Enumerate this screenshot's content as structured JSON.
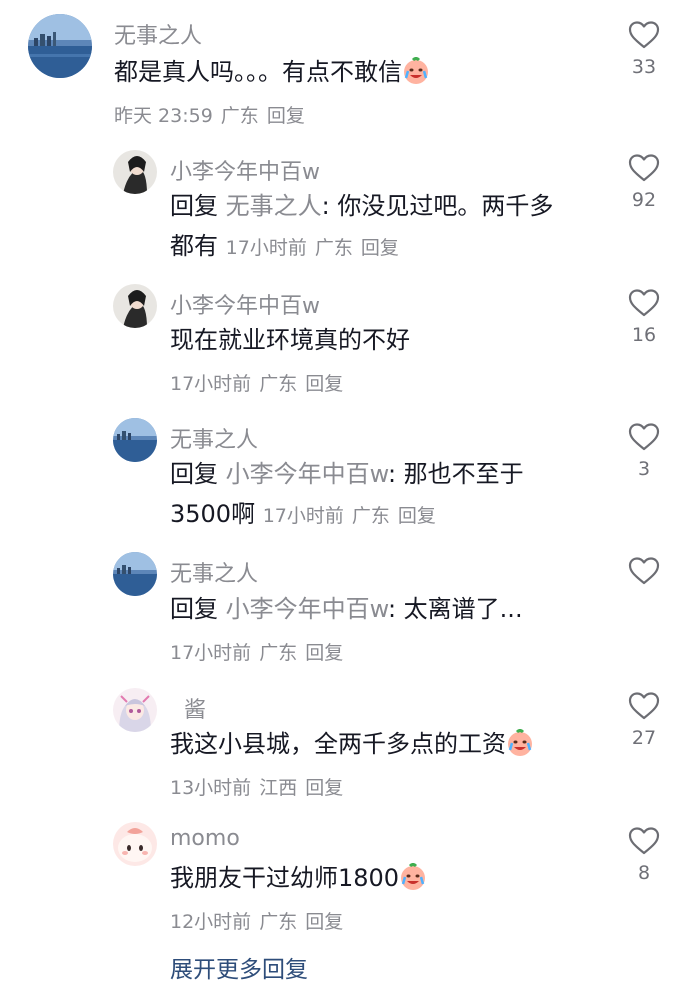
{
  "comments": [
    {
      "name": "无事之人",
      "text": "都是真人吗。。。有点不敢信",
      "emoji": "crying-laugh",
      "time": "昨天 23:59",
      "location": "广东",
      "reply_label": "回复",
      "likes": "33"
    },
    {
      "name": "小李今年中百w",
      "prefix": "回复",
      "reply_to": "无事之人",
      "text_line1": ": 你没见过吧。两千多",
      "text_line2": "都有",
      "time": "17小时前",
      "location": "广东",
      "reply_label": "回复",
      "likes": "92"
    },
    {
      "name": "小李今年中百w",
      "text": "现在就业环境真的不好",
      "time": "17小时前",
      "location": "广东",
      "reply_label": "回复",
      "likes": "16"
    },
    {
      "name": "无事之人",
      "prefix": "回复",
      "reply_to": "小李今年中百w",
      "text_line1": ": 那也不至于",
      "text_line2": "3500啊",
      "time": "17小时前",
      "location": "广东",
      "reply_label": "回复",
      "likes": "3"
    },
    {
      "name": "无事之人",
      "prefix": "回复",
      "reply_to": "小李今年中百w",
      "text": ": 太离谱了...",
      "time": "17小时前",
      "location": "广东",
      "reply_label": "回复",
      "likes": ""
    },
    {
      "name": "酱",
      "text": "我这小县城，全两千多点的工资",
      "emoji": "crying-laugh",
      "time": "13小时前",
      "location": "江西",
      "reply_label": "回复",
      "likes": "27"
    },
    {
      "name": "momo",
      "text": "我朋友干过幼师1800",
      "emoji": "crying-laugh",
      "time": "12小时前",
      "location": "广东",
      "reply_label": "回复",
      "likes": "8"
    }
  ],
  "expand_more": "展开更多回复",
  "colors": {
    "name_gray": "#8a8b91",
    "text_dark": "#161823",
    "link_blue": "#2e4d7a"
  }
}
